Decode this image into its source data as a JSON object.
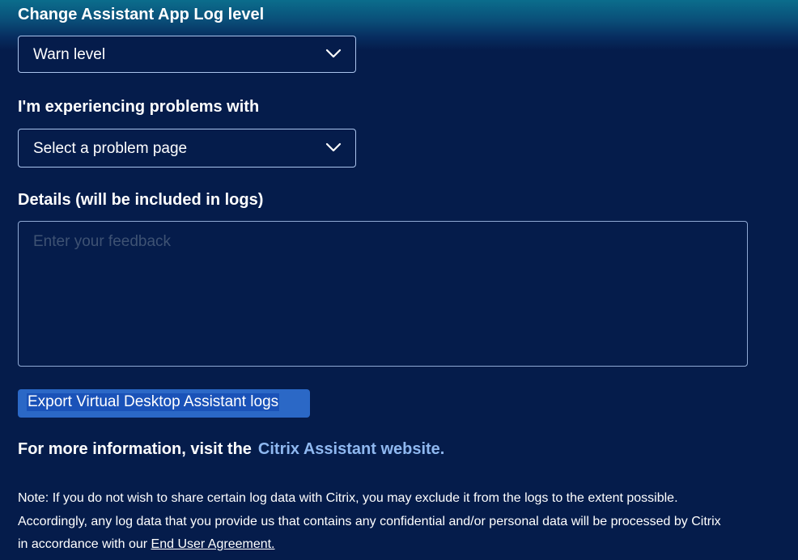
{
  "log_level": {
    "label": "Change Assistant App Log level",
    "selected": "Warn level"
  },
  "problem": {
    "label": "I'm experiencing problems with",
    "selected": "Select a problem page"
  },
  "details": {
    "label": "Details (will be included in logs)",
    "placeholder": "Enter your feedback"
  },
  "export_button": {
    "label": "Export Virtual Desktop Assistant logs"
  },
  "more_info": {
    "text": "For more information, visit the",
    "link": "Citrix Assistant website."
  },
  "note": {
    "line1": "Note: If you do not wish to share certain log data with Citrix, you may exclude it from the logs to the extent possible.",
    "line2": "Accordingly, any log data that you provide us that contains any confidential and/or personal data will be processed by Citrix",
    "line3_prefix": "in accordance with our ",
    "eula_link": "End User Agreement."
  },
  "icons": {
    "dropdown": "chevron-down-icon"
  },
  "colors": {
    "background": "#051c4b",
    "accent_button": "#2b68c6",
    "link": "#8fb8f0"
  }
}
